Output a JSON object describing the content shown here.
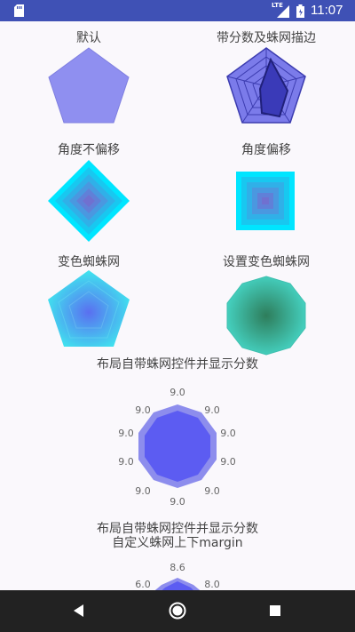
{
  "status_bar": {
    "time": "11:07",
    "network": "LTE",
    "icons": [
      "sd-card-icon",
      "signal-icon",
      "battery-icon"
    ]
  },
  "charts": {
    "default_label": "默认",
    "score_border_label": "带分数及蛛网描边",
    "angle_fixed_label": "角度不偏移",
    "angle_offset_label": "角度偏移",
    "color_change_label": "变色蜘蛛网",
    "set_color_label": "设置变色蜘蛛网",
    "layout_scores_label": "布局自带蛛网控件并显示分数",
    "layout_margin_label_line1": "布局自带蛛网控件并显示分数",
    "layout_margin_label_line2": "自定义蛛网上下margin"
  },
  "scores_decagon": [
    "9.0",
    "9.0",
    "9.0",
    "9.0",
    "9.0",
    "9.0",
    "9.0",
    "9.0",
    "9.0",
    "9.0"
  ],
  "scores_margin": {
    "top": "8.6",
    "left": "6.0",
    "right": "8.0"
  },
  "colors": {
    "accent": "#3f51b5",
    "spider": "#7b7bea",
    "cyan": "#00e5ff",
    "teal": "#26a69a"
  },
  "nav": {
    "icons": [
      "back-icon",
      "home-icon",
      "recents-icon"
    ]
  }
}
